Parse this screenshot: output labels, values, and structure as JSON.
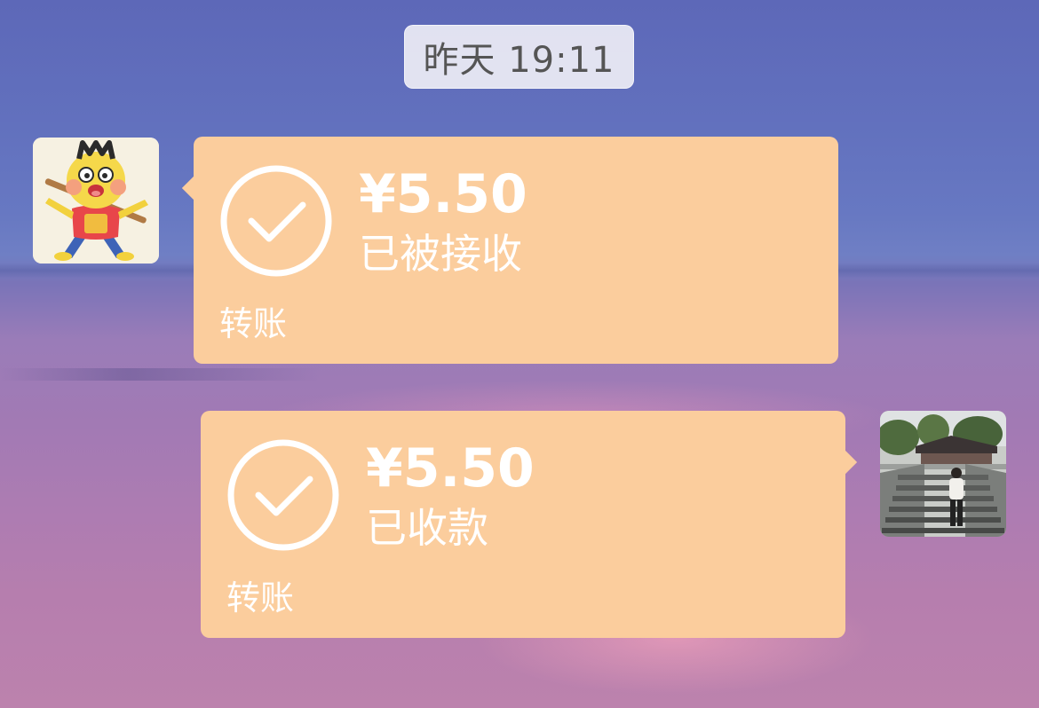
{
  "chat": {
    "timestamp": "昨天 19:11",
    "messages": [
      {
        "sender": "contact",
        "type": "transfer",
        "amount": "¥5.50",
        "status": "已被接收",
        "label": "转账",
        "bubble_color": "#fbcd9d",
        "icon": "check-circle-icon"
      },
      {
        "sender": "self",
        "type": "transfer",
        "amount": "¥5.50",
        "status": "已收款",
        "label": "转账",
        "bubble_color": "#fbcd9d",
        "icon": "check-circle-icon"
      }
    ]
  }
}
